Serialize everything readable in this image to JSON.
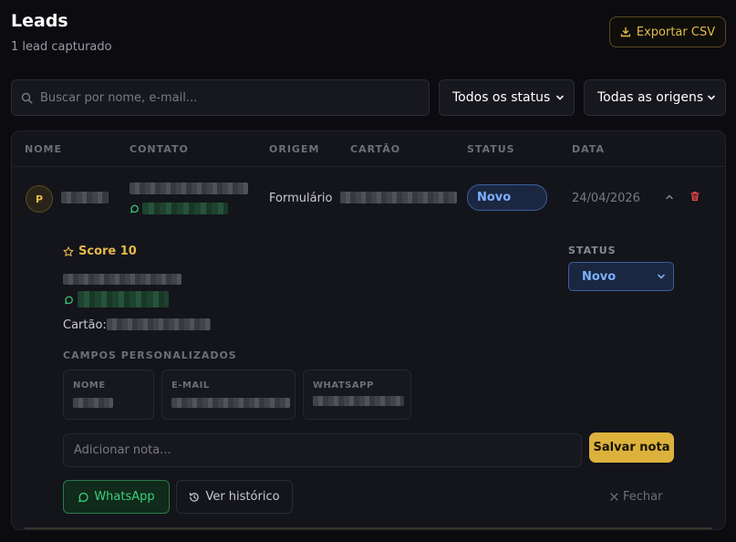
{
  "header": {
    "title": "Leads",
    "subtitle": "1 lead capturado",
    "export_label": "Exportar CSV"
  },
  "filters": {
    "search_placeholder": "Buscar por nome, e-mail...",
    "status_value": "Todos os status",
    "origin_value": "Todas as origens"
  },
  "table": {
    "columns": [
      "NOME",
      "CONTATO",
      "ORIGEM",
      "CARTÃO",
      "STATUS",
      "DATA"
    ],
    "rows": [
      {
        "avatar_initial": "P",
        "origin": "Formulário",
        "status": "Novo",
        "date": "24/04/2026"
      }
    ]
  },
  "detail": {
    "score": "Score 10",
    "status_label": "STATUS",
    "status_value": "Novo",
    "card_label": "Cartão:",
    "custom_fields_title": "CAMPOS PERSONALIZADOS",
    "custom_fields": [
      {
        "label": "NOME"
      },
      {
        "label": "E-MAIL"
      },
      {
        "label": "WHATSAPP"
      }
    ],
    "note_placeholder": "Adicionar nota...",
    "save_note_label": "Salvar nota",
    "whatsapp_label": "WhatsApp",
    "history_label": "Ver histórico",
    "close_label": "Fechar"
  },
  "colors": {
    "accent": "#dcb23c",
    "status_blue": "#7ab0ff",
    "whatsapp_green": "#3ad07a",
    "delete_red": "#e04848"
  }
}
